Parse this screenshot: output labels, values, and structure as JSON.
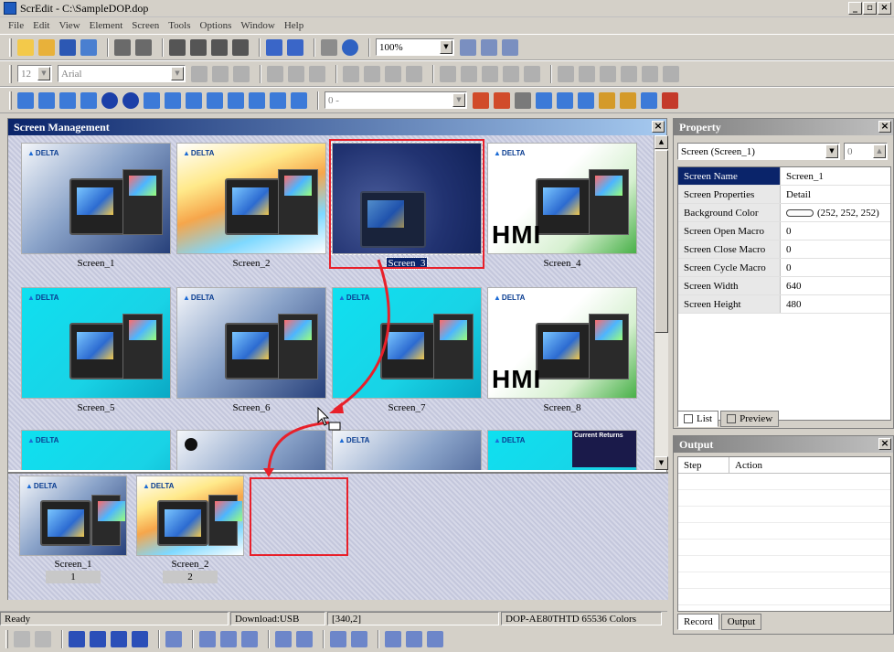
{
  "window": {
    "title": "ScrEdit - C:\\SampleDOP.dop"
  },
  "menu": [
    "File",
    "Edit",
    "View",
    "Element",
    "Screen",
    "Tools",
    "Options",
    "Window",
    "Help"
  ],
  "toolbar1": {
    "zoom": "100%"
  },
  "toolbar2": {
    "font_size": "12",
    "font_name": "Arial"
  },
  "toolbar3": {
    "field": "0 -"
  },
  "screen_management": {
    "title": "Screen Management",
    "screens": [
      {
        "name": "Screen_1",
        "style": "blue",
        "logo": "DELTA"
      },
      {
        "name": "Screen_2",
        "style": "rainbow",
        "logo": "DELTA"
      },
      {
        "name": "Screen_3",
        "style": "dark",
        "logo": ""
      },
      {
        "name": "Screen_4",
        "style": "green",
        "logo": "DELTA",
        "hmi": "HMI"
      },
      {
        "name": "Screen_5",
        "style": "cyan",
        "logo": "DELTA"
      },
      {
        "name": "Screen_6",
        "style": "blue",
        "logo": "DELTA"
      },
      {
        "name": "Screen_7",
        "style": "cyan",
        "logo": "DELTA"
      },
      {
        "name": "Screen_8",
        "style": "green",
        "logo": "DELTA",
        "hmi": "HMI"
      }
    ],
    "selected": "Screen_3",
    "partial_row_text": "Current Returns",
    "sequence": [
      {
        "name": "Screen_1",
        "index": "1"
      },
      {
        "name": "Screen_2",
        "index": "2"
      }
    ]
  },
  "property": {
    "title": "Property",
    "selector": "Screen (Screen_1)",
    "spin": "0",
    "rows": [
      {
        "key": "Screen Name",
        "value": "Screen_1"
      },
      {
        "key": "Screen Properties",
        "value": "Detail"
      },
      {
        "key": "Background Color",
        "value": "(252, 252, 252)"
      },
      {
        "key": "Screen Open Macro",
        "value": "0"
      },
      {
        "key": "Screen Close Macro",
        "value": "0"
      },
      {
        "key": "Screen Cycle Macro",
        "value": "0"
      },
      {
        "key": "Screen Width",
        "value": "640"
      },
      {
        "key": "Screen Height",
        "value": "480"
      }
    ],
    "tabs": {
      "list": "List",
      "preview": "Preview"
    }
  },
  "output": {
    "title": "Output",
    "columns": {
      "step": "Step",
      "action": "Action"
    },
    "tabs": {
      "record": "Record",
      "output": "Output"
    }
  },
  "status": {
    "ready": "Ready",
    "download": "Download:USB",
    "coords": "[340,2]",
    "model": "DOP-AE80THTD 65536 Colors"
  },
  "colors": {
    "accent_red": "#e8202a",
    "title_blue": "#0a246a"
  }
}
